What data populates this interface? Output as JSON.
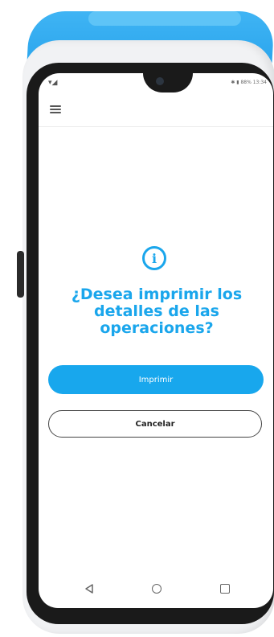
{
  "status_bar": {
    "signal": "▾◢",
    "right_info": "✱ ▮ 88% 13:34"
  },
  "dialog": {
    "title": "¿Desea imprimir los detalles de las operaciones?",
    "icon": "info-icon",
    "icon_glyph": "i"
  },
  "buttons": {
    "print_label": "Imprimir",
    "cancel_label": "Cancelar"
  },
  "navigation": {
    "icons": [
      "back-icon",
      "home-icon",
      "recent-apps-icon"
    ]
  },
  "colors": {
    "accent": "#1aa6ec",
    "device_top": "#1e9ce8"
  }
}
